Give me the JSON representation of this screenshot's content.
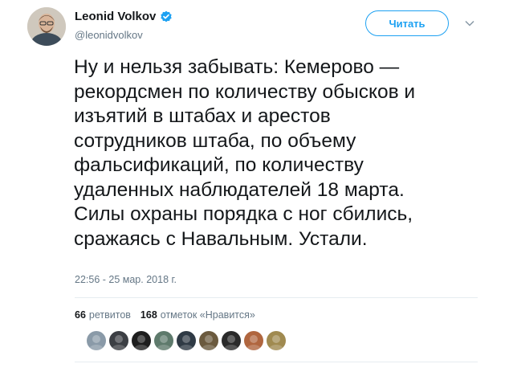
{
  "author": {
    "name": "Leonid Volkov",
    "handle": "@leonidvolkov",
    "verified": true
  },
  "follow_button_label": "Читать",
  "tweet": {
    "text": "Ну и нельзя забывать: Кемерово —\nрекордсмен по количеству обысков и\nизъятий в штабах и арестов\nсотрудников штаба, по объему\nфальсификаций, по количеству\nудаленных наблюдателей 18 марта.\nСилы охраны порядка с ног сбились,\nсражаясь с Навальным. Устали.",
    "timestamp": "22:56 - 25 мар. 2018 г."
  },
  "stats": {
    "retweets_count": "66",
    "retweets_label": "ретвитов",
    "likes_count": "168",
    "likes_label": "отметок «Нравится»"
  },
  "liker_avatars": [
    {
      "icon": "avatar-1",
      "color": "#8a9aa8"
    },
    {
      "icon": "avatar-2",
      "color": "#3c3f44"
    },
    {
      "icon": "avatar-3",
      "color": "#1e1e1e"
    },
    {
      "icon": "avatar-4",
      "color": "#5e7a6c"
    },
    {
      "icon": "avatar-5",
      "color": "#2f3a45"
    },
    {
      "icon": "avatar-6",
      "color": "#6b5a3e"
    },
    {
      "icon": "avatar-7",
      "color": "#2a2a2a"
    },
    {
      "icon": "avatar-8",
      "color": "#b0663f"
    },
    {
      "icon": "avatar-9",
      "color": "#a08a50"
    }
  ],
  "colors": {
    "accent": "#1da1f2",
    "verified_badge": "#1da1f2",
    "secondary_text": "#657786",
    "primary_text": "#14171a"
  }
}
